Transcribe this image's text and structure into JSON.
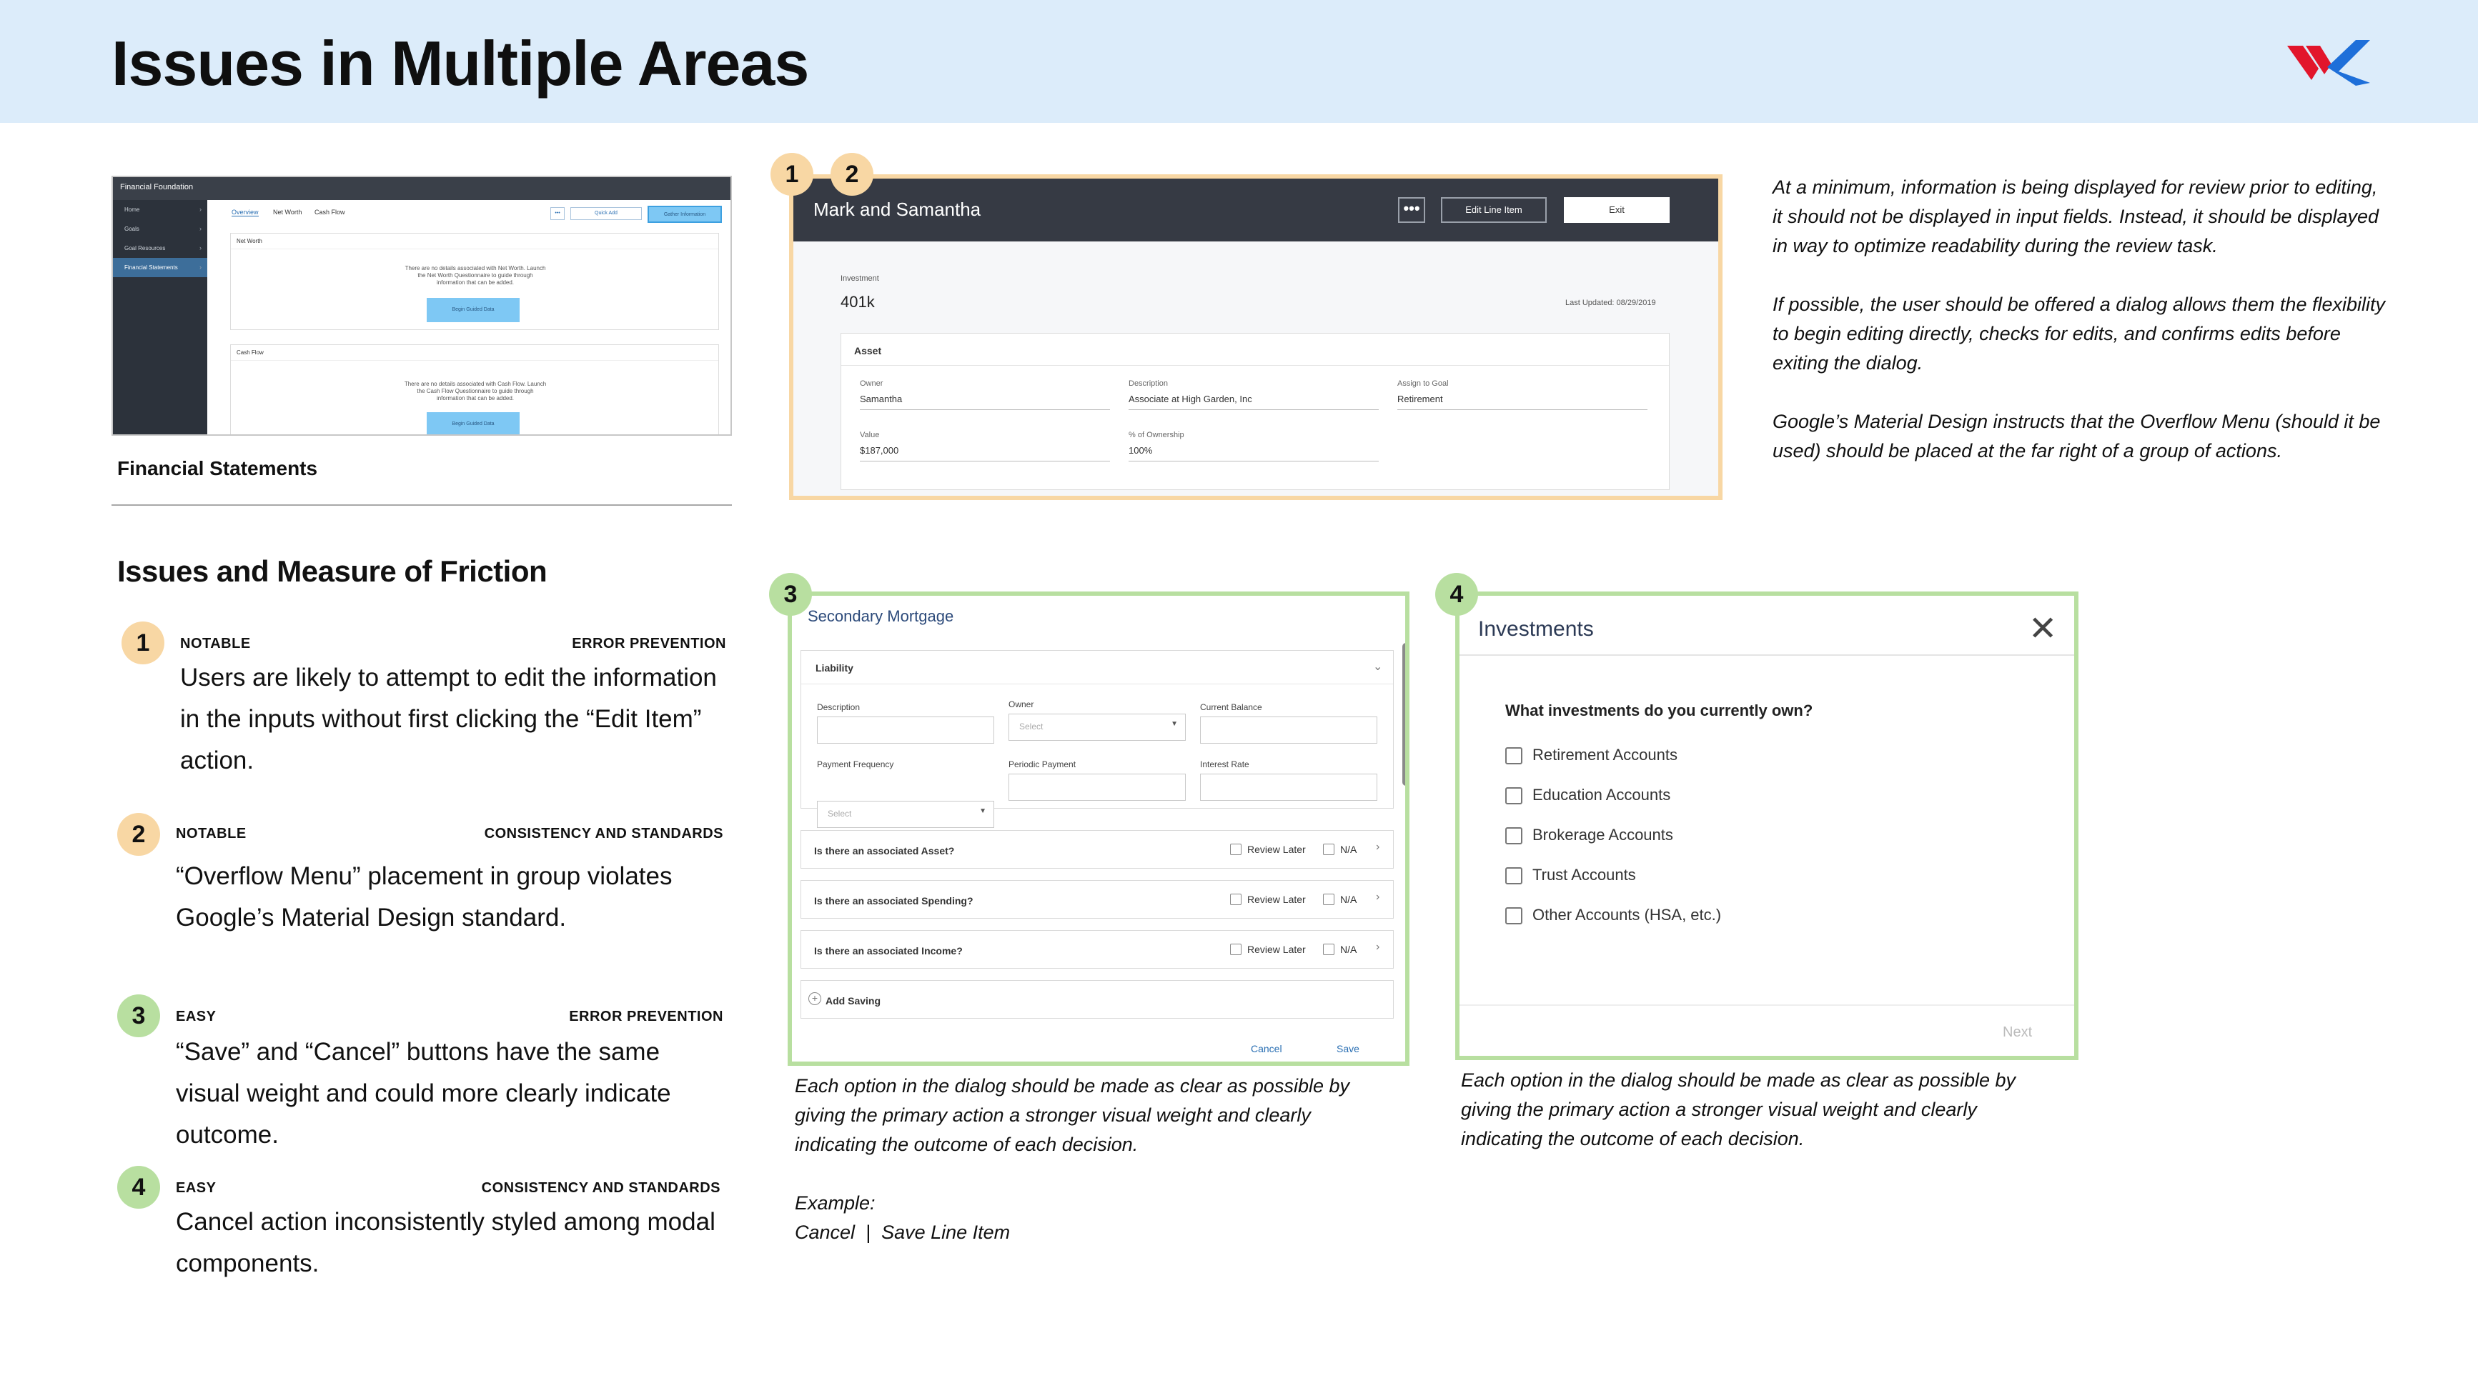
{
  "header": {
    "title": "Issues in Multiple Areas"
  },
  "brand": {
    "logo_colors": [
      "#e2152b",
      "#1e6fd9"
    ]
  },
  "thumbnail": {
    "app_title": "Financial Foundation",
    "sidebar": [
      "Home",
      "Goals",
      "Goal Resources",
      "Financial Statements"
    ],
    "tabs": [
      "Overview",
      "Net Worth",
      "Cash Flow"
    ],
    "buttons": {
      "more": "•••",
      "quick_add": "Quick Add",
      "gather": "Gather Information"
    },
    "net_worth": {
      "title": "Net Worth",
      "text": "There are no details associated with Net Worth. Launch the Net Worth Questionnaire to guide through information that can be added.",
      "button": "Begin Guided Data"
    },
    "cash_flow": {
      "title": "Cash Flow",
      "text": "There are no details associated with Cash Flow. Launch the Cash Flow Questionnaire to guide through information that can be added.",
      "button": "Begin Guided Data"
    },
    "caption": "Financial Statements"
  },
  "issues": {
    "title": "Issues and Measure of Friction",
    "items": [
      {
        "number": "1",
        "severity": "NOTABLE",
        "category": "ERROR PREVENTION",
        "text": "Users are likely to attempt to edit the information in the inputs without first clicking the “Edit Item” action."
      },
      {
        "number": "2",
        "severity": "NOTABLE",
        "category": "CONSISTENCY AND STANDARDS",
        "text": "“Overflow Menu” placement in group violates Google’s Material Design standard."
      },
      {
        "number": "3",
        "severity": "EASY",
        "category": "ERROR PREVENTION",
        "text": "“Save” and “Cancel” buttons have the same visual weight and could more clearly indicate outcome."
      },
      {
        "number": "4",
        "severity": "EASY",
        "category": "CONSISTENCY AND STANDARDS",
        "text": "Cancel action inconsistently styled among modal components."
      }
    ]
  },
  "mock1": {
    "badges": [
      "1",
      "2"
    ],
    "title": "Mark and Samantha",
    "more": "•••",
    "edit_button": "Edit Line Item",
    "exit_button": "Exit",
    "investment_label": "Investment",
    "investment_value": "401k",
    "last_updated": "Last Updated: 08/29/2019",
    "card_title": "Asset",
    "fields": [
      {
        "label": "Owner",
        "value": "Samantha"
      },
      {
        "label": "Description",
        "value": "Associate at High Garden, Inc"
      },
      {
        "label": "Assign to Goal",
        "value": "Retirement"
      },
      {
        "label": "Value",
        "value": "$187,000"
      },
      {
        "label": "% of Ownership",
        "value": "100%"
      }
    ]
  },
  "note1": {
    "paragraphs": [
      "At a minimum, information is being displayed for review prior to editing, it should not be displayed in input fields. Instead, it should be displayed in way to optimize readability during the review task.",
      "If possible, the user should be offered a dialog allows them the flexibility to begin editing directly, checks for edits, and confirms edits before exiting the dialog.",
      "Google’s Material Design instructs that the Overflow Menu (should it be used) should be placed at the far right of a group of actions."
    ]
  },
  "mock3": {
    "badge": "3",
    "title": "Secondary Mortgage",
    "section": "Liability",
    "fields": {
      "description": "Description",
      "owner": "Owner",
      "owner_placeholder": "Select",
      "current_balance": "Current Balance",
      "payment_frequency": "Payment Frequency",
      "frequency_placeholder": "Select",
      "periodic_payment": "Periodic Payment",
      "interest_rate": "Interest Rate"
    },
    "questions": [
      "Is there an associated Asset?",
      "Is there an associated Spending?",
      "Is there an associated Income?"
    ],
    "review_later": "Review Later",
    "na": "N/A",
    "add_saving": "Add Saving",
    "cancel": "Cancel",
    "save": "Save"
  },
  "note3": {
    "text": "Each option in the dialog should be made as clear as possible by giving the primary action a stronger visual weight and clearly indicating the outcome of each decision.",
    "example_label": "Example:",
    "example": "Cancel  |  Save Line Item"
  },
  "mock4": {
    "badge": "4",
    "title": "Investments",
    "close": "✕",
    "question": "What investments do you currently own?",
    "options": [
      "Retirement Accounts",
      "Education Accounts",
      "Brokerage Accounts",
      "Trust Accounts",
      "Other Accounts (HSA, etc.)"
    ],
    "next": "Next"
  },
  "note4": {
    "text": "Each option in the dialog should be made as clear as possible by giving the primary action a stronger visual weight and clearly indicating the outcome of each decision."
  }
}
